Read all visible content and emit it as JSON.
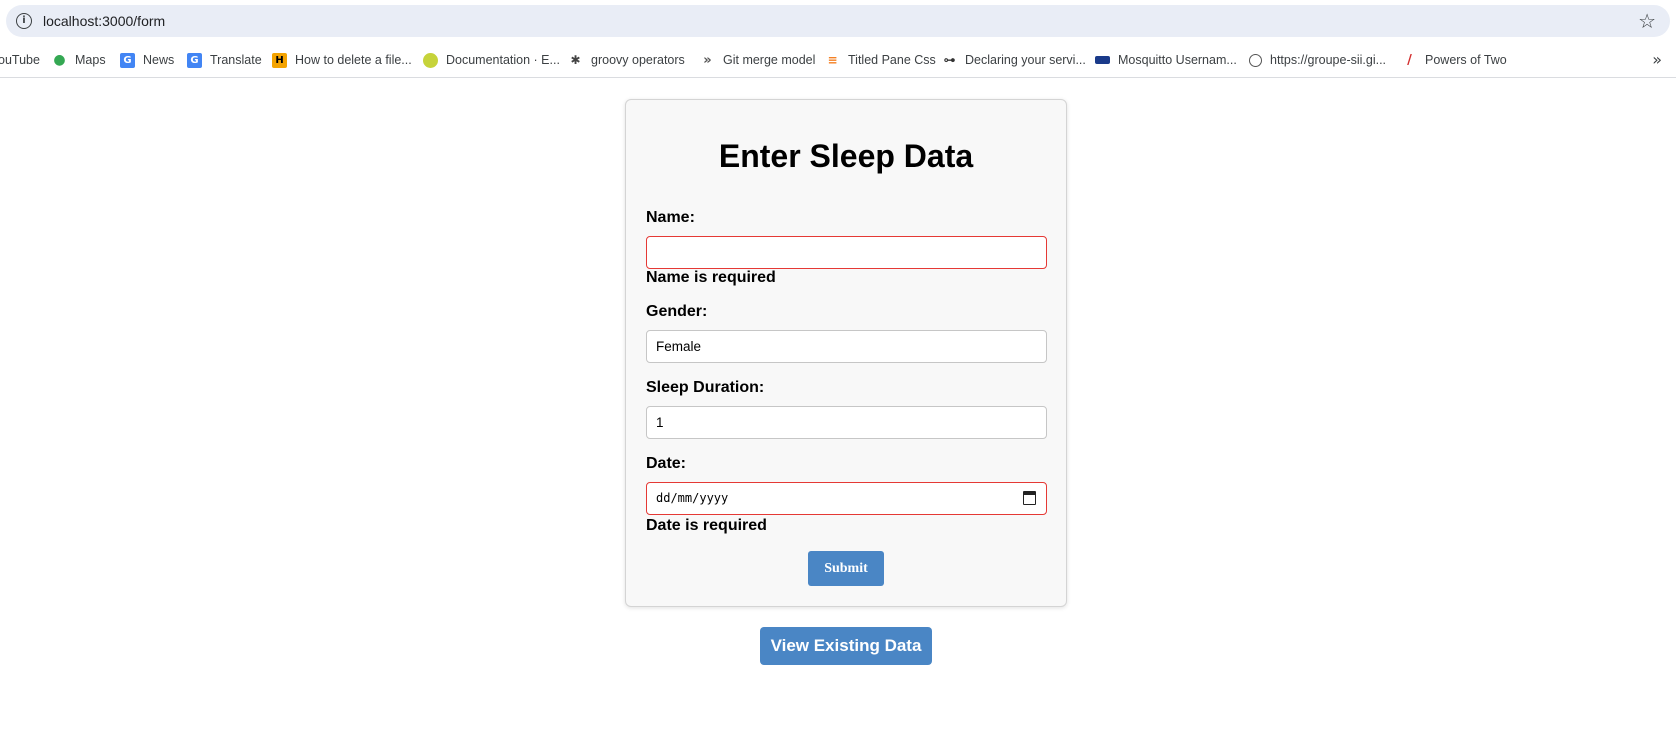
{
  "browser": {
    "url": "localhost:3000/form",
    "bookmarks": [
      {
        "label": "ouTube",
        "icon": "youtube-icon"
      },
      {
        "label": "Maps",
        "icon": "maps-pin-icon"
      },
      {
        "label": "News",
        "icon": "news-icon"
      },
      {
        "label": "Translate",
        "icon": "translate-icon"
      },
      {
        "label": "How to delete a file...",
        "icon": "site-icon"
      },
      {
        "label": "Documentation · E...",
        "icon": "docs-icon"
      },
      {
        "label": "groovy operators",
        "icon": "ant-icon"
      },
      {
        "label": "Git merge model",
        "icon": "chevrons-icon"
      },
      {
        "label": "Titled Pane Css",
        "icon": "stackoverflow-icon"
      },
      {
        "label": "Declaring your servi...",
        "icon": "network-icon"
      },
      {
        "label": "Mosquitto Usernam...",
        "icon": "flag-icon"
      },
      {
        "label": "https://groupe-sii.gi...",
        "icon": "globe-icon"
      },
      {
        "label": "Powers of Two",
        "icon": "feather-icon"
      }
    ]
  },
  "form": {
    "title": "Enter Sleep Data",
    "name_label": "Name:",
    "name_value": "",
    "name_error": "Name is required",
    "gender_label": "Gender:",
    "gender_value": "Female",
    "duration_label": "Sleep Duration:",
    "duration_value": "1",
    "date_label": "Date:",
    "date_placeholder": "dd/mm/yyyy",
    "date_error": "Date is required",
    "submit_label": "Submit"
  },
  "view_button_label": "View Existing Data",
  "colors": {
    "button": "#4a86c5",
    "error_border": "#e53935"
  }
}
